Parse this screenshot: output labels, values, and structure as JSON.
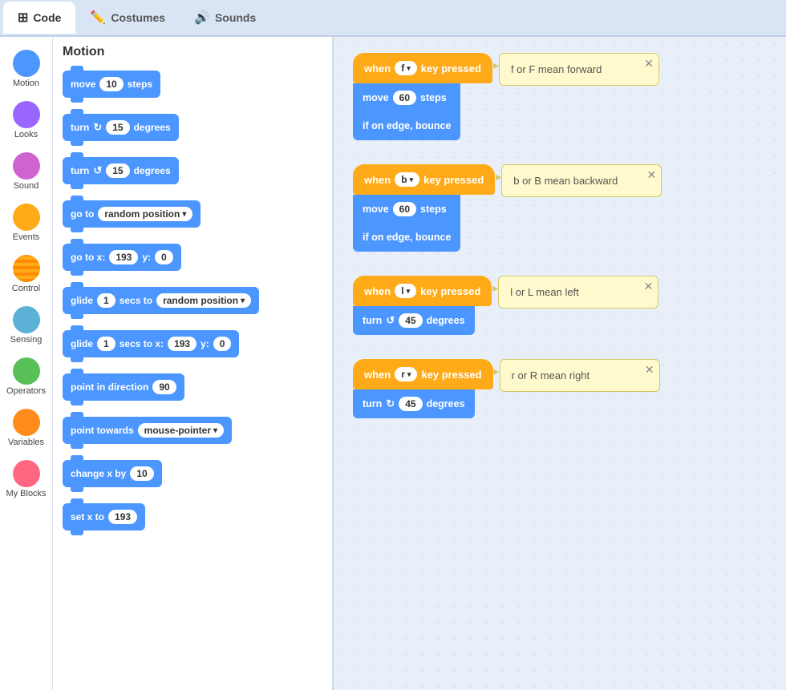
{
  "tabs": [
    {
      "label": "Code",
      "icon": "⊞",
      "active": true
    },
    {
      "label": "Costumes",
      "icon": "✏️",
      "active": false
    },
    {
      "label": "Sounds",
      "icon": "🔊",
      "active": false
    }
  ],
  "sidebar": {
    "items": [
      {
        "label": "Motion",
        "color": "#4c97ff",
        "active": true
      },
      {
        "label": "Looks",
        "color": "#9966ff"
      },
      {
        "label": "Sound",
        "color": "#cf63cf"
      },
      {
        "label": "Events",
        "color": "#ffab19"
      },
      {
        "label": "Control",
        "color": "#ffab19"
      },
      {
        "label": "Sensing",
        "color": "#5cb1d6"
      },
      {
        "label": "Operators",
        "color": "#59c059"
      },
      {
        "label": "Variables",
        "color": "#ff8c1a"
      },
      {
        "label": "My Blocks",
        "color": "#ff6680"
      }
    ]
  },
  "block_panel_title": "Motion",
  "blocks": [
    {
      "type": "move",
      "label": "move",
      "value": "10",
      "suffix": "steps"
    },
    {
      "type": "turn_cw",
      "label": "turn",
      "icon": "↻",
      "value": "15",
      "suffix": "degrees"
    },
    {
      "type": "turn_ccw",
      "label": "turn",
      "icon": "↺",
      "value": "15",
      "suffix": "degrees"
    },
    {
      "type": "goto",
      "label": "go to",
      "dropdown": "random position"
    },
    {
      "type": "goto_xy",
      "label": "go to x:",
      "x": "193",
      "y_label": "y:",
      "y": "0"
    },
    {
      "type": "glide_to",
      "label": "glide",
      "value": "1",
      "secs": "secs to",
      "dropdown": "random position"
    },
    {
      "type": "glide_xy",
      "label": "glide",
      "value": "1",
      "secs": "secs to x:",
      "x": "193",
      "y_label": "y:",
      "y": "0"
    },
    {
      "type": "point_dir",
      "label": "point in direction",
      "value": "90"
    },
    {
      "type": "point_towards",
      "label": "point towards",
      "dropdown": "mouse-pointer"
    },
    {
      "type": "change_x",
      "label": "change x by",
      "value": "10"
    },
    {
      "type": "set_x",
      "label": "set x to",
      "value": "193"
    }
  ],
  "scripts": [
    {
      "event_text": "when",
      "key": "f",
      "key_suffix": "key pressed",
      "actions": [
        {
          "label": "move",
          "value": "60",
          "suffix": "steps"
        },
        {
          "label": "if on edge, bounce"
        }
      ],
      "note": "f or F mean forward"
    },
    {
      "event_text": "when",
      "key": "b",
      "key_suffix": "key pressed",
      "actions": [
        {
          "label": "move",
          "value": "60",
          "suffix": "steps"
        },
        {
          "label": "if on edge, bounce"
        }
      ],
      "note": "b or B mean backward"
    },
    {
      "event_text": "when",
      "key": "l",
      "key_suffix": "key pressed",
      "actions": [
        {
          "label": "turn",
          "icon": "↺",
          "value": "45",
          "suffix": "degrees"
        }
      ],
      "note": "l or L mean left"
    },
    {
      "event_text": "when",
      "key": "r",
      "key_suffix": "key pressed",
      "actions": [
        {
          "label": "turn",
          "icon": "↻",
          "value": "45",
          "suffix": "degrees"
        }
      ],
      "note": "r or R mean right"
    }
  ]
}
